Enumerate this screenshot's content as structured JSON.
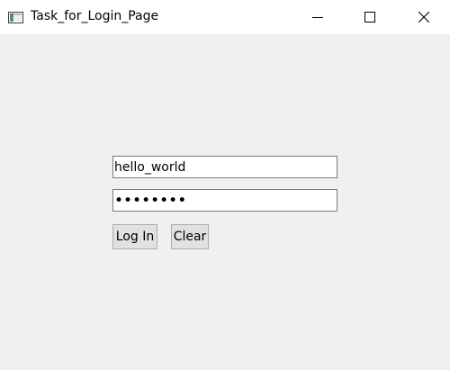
{
  "window": {
    "title": "Task_for_Login_Page",
    "icon": "app-window-icon",
    "controls": {
      "minimize": "minimize-icon",
      "maximize": "maximize-icon",
      "close": "close-icon"
    }
  },
  "form": {
    "username_value": "hello_world",
    "password_display": "••••••••",
    "login_label": "Log In",
    "clear_label": "Clear"
  },
  "colors": {
    "titlebar_bg": "#ffffff",
    "window_bg": "#f0f0f0",
    "button_bg": "#e1e1e1",
    "input_border": "#7a7a7a"
  }
}
